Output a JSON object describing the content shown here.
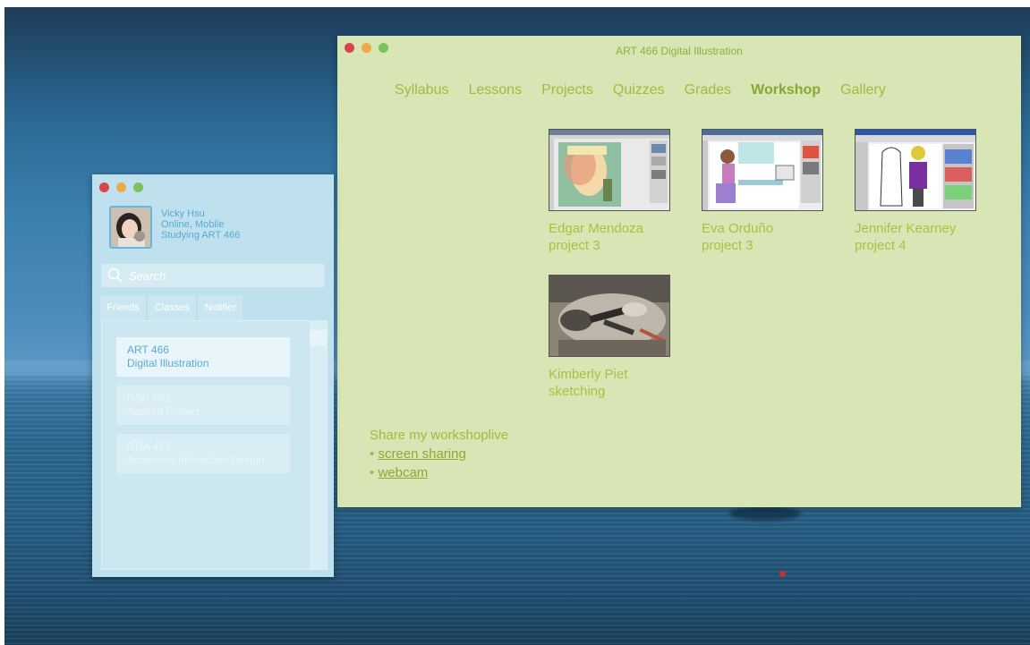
{
  "main_window": {
    "title": "ART 466 Digital Illustration",
    "tabs": [
      {
        "label": "Syllabus"
      },
      {
        "label": "Lessons"
      },
      {
        "label": "Projects"
      },
      {
        "label": "Quizzes"
      },
      {
        "label": "Grades"
      },
      {
        "label": "Workshop",
        "active": true
      },
      {
        "label": "Gallery"
      }
    ],
    "workshop_items": [
      {
        "line1": "Edgar Mendoza",
        "line2": "project 3"
      },
      {
        "line1": "Eva Orduño",
        "line2": "project 3"
      },
      {
        "line1": "Jennifer Kearney",
        "line2": "project 4"
      },
      {
        "line1": "Kimberly Piet",
        "line2": "sketching"
      }
    ],
    "share": {
      "heading": "Share my workshoplive",
      "bullet": "•",
      "screen_sharing": "screen sharing",
      "webcam": "webcam"
    }
  },
  "buddy_window": {
    "profile": {
      "name": "Vicky Hsu",
      "status": "Online, Mobile",
      "activity": "Studying ART 466"
    },
    "search_placeholder": "Search",
    "tabs": [
      "Friends",
      "Classes",
      "Notifier"
    ],
    "courses": [
      {
        "code": "ART 466",
        "name": "Digital Illustration",
        "active": true
      },
      {
        "code": "DSC 593",
        "name": "Applied Project",
        "active": false
      },
      {
        "code": "GRA 423",
        "name": "Advanced Interaction Design",
        "active": false
      }
    ]
  },
  "colors": {
    "main_bg": "#d8e6b5",
    "accent_green": "#9dbc40",
    "buddy_bg": "#bfe1ee",
    "buddy_accent": "#59a9d6"
  }
}
